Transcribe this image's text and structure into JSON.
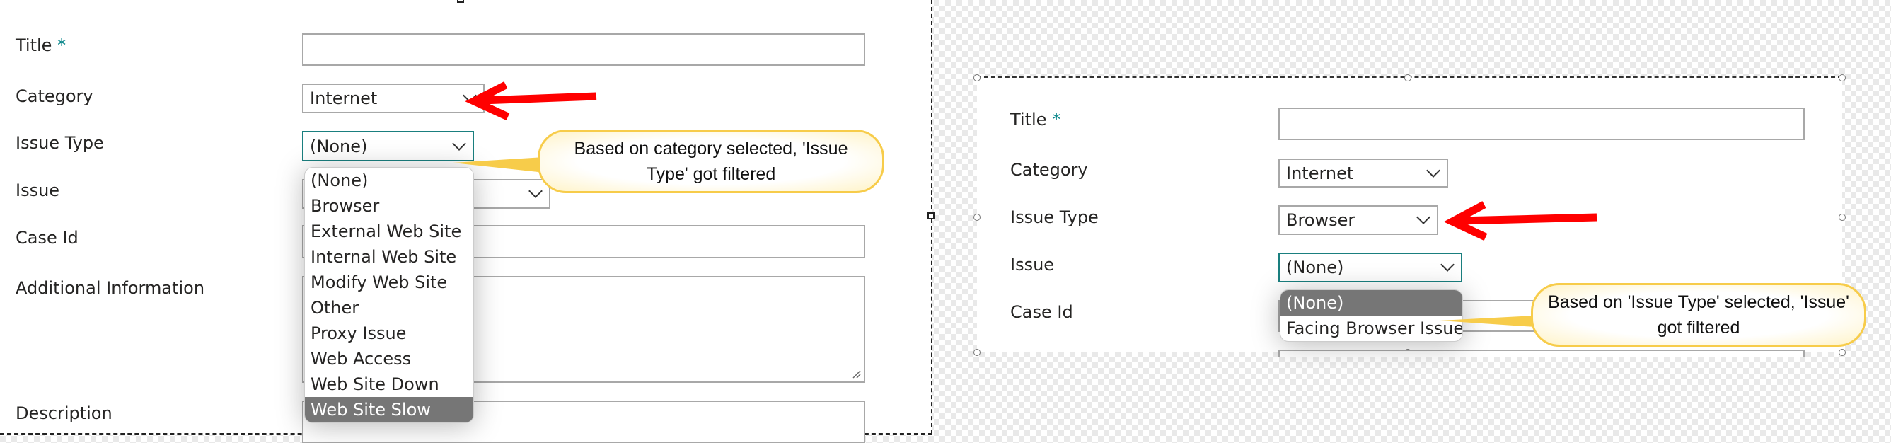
{
  "left_form": {
    "fields": {
      "title": {
        "label": "Title",
        "required_marker": "*",
        "value": ""
      },
      "category": {
        "label": "Category",
        "value": "Internet"
      },
      "issue_type": {
        "label": "Issue Type",
        "value": "(None)"
      },
      "issue": {
        "label": "Issue",
        "value": ""
      },
      "case_id": {
        "label": "Case Id",
        "value": ""
      },
      "additional_information": {
        "label": "Additional Information",
        "value": ""
      },
      "description": {
        "label": "Description",
        "value": ""
      }
    },
    "issue_type_dropdown": {
      "options": [
        "(None)",
        "Browser",
        "External Web Site",
        "Internal Web Site",
        "Modify Web Site",
        "Other",
        "Proxy Issue",
        "Web Access",
        "Web Site Down",
        "Web Site Slow"
      ],
      "highlighted": "Web Site Slow"
    },
    "callout": "Based on category selected, 'Issue Type' got filtered"
  },
  "right_form": {
    "fields": {
      "title": {
        "label": "Title",
        "required_marker": "*",
        "value": ""
      },
      "category": {
        "label": "Category",
        "value": "Internet"
      },
      "issue_type": {
        "label": "Issue Type",
        "value": "Browser"
      },
      "issue": {
        "label": "Issue",
        "value": "(None)"
      },
      "case_id": {
        "label": "Case Id",
        "value": ""
      }
    },
    "issue_dropdown": {
      "options": [
        "(None)",
        "Facing Browser Issue"
      ],
      "highlighted": "(None)"
    },
    "callout": "Based on 'Issue Type' selected, 'Issue' got filtered"
  },
  "colors": {
    "accent": "#038387",
    "focus_border": "#1a7f7f",
    "arrow": "#ff0000",
    "callout_border": "#f7cc4a",
    "highlight": "#767676"
  },
  "icons": {
    "annotation_arrow": "red-arrow-left",
    "select_chevron": "chevron-down"
  }
}
